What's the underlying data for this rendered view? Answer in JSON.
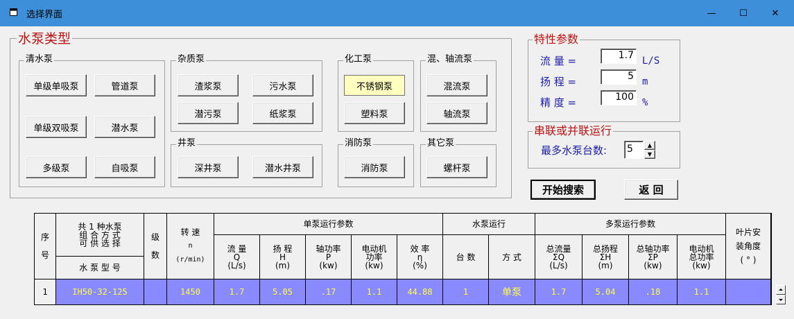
{
  "window": {
    "title": "选择界面",
    "minimize": "—",
    "maximize": "☐",
    "close": "✕"
  },
  "pump_types": {
    "legend": "水泵类型",
    "qingshui": {
      "legend": "清水泵",
      "buttons": [
        "单级单吸泵",
        "管道泵",
        "单级双吸泵",
        "潜水泵",
        "多级泵",
        "自吸泵"
      ]
    },
    "zazhi": {
      "legend": "杂质泵",
      "buttons": [
        "渣浆泵",
        "污水泵",
        "潜污泵",
        "纸浆泵"
      ]
    },
    "jing": {
      "legend": "井泵",
      "buttons": [
        "深井泵",
        "潜水井泵"
      ]
    },
    "huagong": {
      "legend": "化工泵",
      "buttons": [
        "不锈钢泵",
        "塑料泵"
      ]
    },
    "xiaofang": {
      "legend": "消防泵",
      "buttons": [
        "消防泵"
      ]
    },
    "hunzhou": {
      "legend": "混、轴流泵",
      "buttons": [
        "混流泵",
        "轴流泵"
      ]
    },
    "qita": {
      "legend": "其它泵",
      "buttons": [
        "螺杆泵"
      ]
    }
  },
  "params": {
    "legend": "特性参数",
    "flow": {
      "label": "流  量 =",
      "value": "1.7",
      "unit": "L/S"
    },
    "head": {
      "label": "扬  程 =",
      "value": "5",
      "unit": "m"
    },
    "precision": {
      "label": "精  度 =",
      "value": "100",
      "unit": "%"
    }
  },
  "series": {
    "legend": "串联或并联运行",
    "label": "最多水泵台数:",
    "value": "5"
  },
  "actions": {
    "search": "开始搜索",
    "back": "返  回"
  },
  "table": {
    "h_seq_1": "序",
    "h_seq_2": "号",
    "h_model_top_1": "共 1 种水泵",
    "h_model_top_2": "组 合 方 式",
    "h_model_top_3": "可 供 选 择",
    "h_model": "水 泵 型 号",
    "h_stage_1": "级",
    "h_stage_2": "数",
    "h_speed": "转  速",
    "h_speed_sym": "n",
    "h_speed_unit": "(r/min)",
    "h_single": "单泵运行参数",
    "h_flow_1": "流  量",
    "h_flow_2": "Q",
    "h_flow_3": "(L/s)",
    "h_head_1": "扬  程",
    "h_head_2": "H",
    "h_head_3": "(m)",
    "h_shaft_1": "轴功率",
    "h_shaft_2": "P",
    "h_shaft_3": "(kw)",
    "h_motor_1": "电动机",
    "h_motor_2": "功率",
    "h_motor_3": "(kw)",
    "h_eff_1": "效  率",
    "h_eff_2": "η",
    "h_eff_3": "(%)",
    "h_run": "水泵运行",
    "h_count": "台  数",
    "h_mode": "方  式",
    "h_multi": "多泵运行参数",
    "h_tflow_1": "总流量",
    "h_tflow_2": "ΣQ",
    "h_tflow_3": "(L/s)",
    "h_thead_1": "总扬程",
    "h_thead_2": "ΣH",
    "h_thead_3": "(m)",
    "h_tshaft_1": "总轴功率",
    "h_tshaft_2": "ΣP",
    "h_tshaft_3": "(kw)",
    "h_tmotor_1": "电动机",
    "h_tmotor_2": "总功率",
    "h_tmotor_3": "(kw)",
    "h_blade_1": "叶片安",
    "h_blade_2": "装角度",
    "h_blade_3": "( ° )",
    "rows": [
      {
        "seq": "1",
        "model": "IH50-32-125",
        "stage": "",
        "speed": "1450",
        "flow": "1.7",
        "head": "5.05",
        "shaft": ".17",
        "motor": "1.1",
        "eff": "44.88",
        "count": "1",
        "mode": "单泵",
        "tflow": "1.7",
        "thead": "5.04",
        "tshaft": ".18",
        "tmotor": "1.1",
        "blade": ""
      }
    ]
  }
}
